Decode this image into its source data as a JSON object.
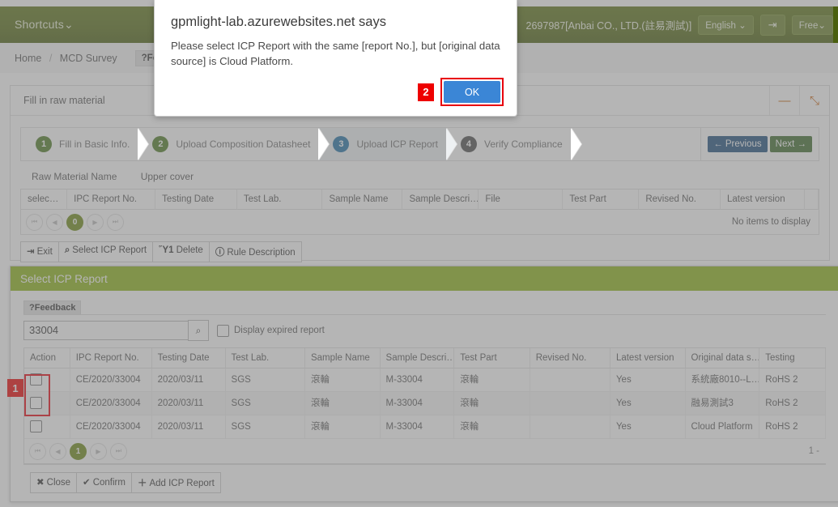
{
  "topbar": {
    "shortcuts_label": "Shortcuts",
    "chevron": "⌄",
    "user_info": "2697987[Anbai CO., LTD.(註易測試)]",
    "language_label": "English",
    "language_chevron": "⌄",
    "logout_icon": "⇥",
    "plan_label": "Free",
    "plan_chevron": "⌄"
  },
  "breadcrumb": {
    "home": "Home",
    "separator": "/",
    "section": "MCD Survey",
    "feedback_tab": "?Feedback"
  },
  "card": {
    "title": "Fill in raw material",
    "minimize_icon": "—",
    "expand_icon": "⤡"
  },
  "wizard": {
    "steps": [
      {
        "num": "1",
        "label": "Fill in Basic Info.",
        "state": "done"
      },
      {
        "num": "2",
        "label": "Upload Composition Datasheet",
        "state": "done"
      },
      {
        "num": "3",
        "label": "Upload ICP Report",
        "state": "active"
      },
      {
        "num": "4",
        "label": "Verify Compliance",
        "state": "pending"
      }
    ],
    "previous_label": "Previous",
    "previous_arrow": "←",
    "next_label": "Next",
    "next_arrow": "→"
  },
  "raw_material": {
    "label": "Raw Material Name",
    "value": "Upper cover"
  },
  "upper_grid": {
    "columns": [
      "selec…",
      "IPC Report No.",
      "Testing Date",
      "Test Lab.",
      "Sample Name",
      "Sample Descri…",
      "File",
      "Test Part",
      "Revised No.",
      "Latest version",
      ""
    ],
    "pager": {
      "first": "⏮",
      "prev": "◀",
      "page": "0",
      "next": "▶",
      "last": "⏭"
    },
    "empty_text": "No items to display"
  },
  "toolbar": {
    "buttons": [
      {
        "glyph": "⇥",
        "label": "Exit"
      },
      {
        "glyph": "⌕",
        "label": "Select ICP Report"
      },
      {
        "glyph": "Ὕ1",
        "label": "Delete"
      },
      {
        "glyph": "ⓘ",
        "label": "Rule Description"
      }
    ]
  },
  "modal": {
    "title": "Select ICP Report",
    "feedback_tab": "?Feedback",
    "search_value": "33004",
    "search_placeholder": "",
    "search_icon": "⌕",
    "expired_checkbox_label": "Display expired report",
    "columns": [
      "Action",
      "IPC Report No.",
      "Testing Date",
      "Test Lab.",
      "Sample Name",
      "Sample Descri…",
      "Test Part",
      "Revised No.",
      "Latest version",
      "Original data s…",
      "Testing"
    ],
    "rows": [
      {
        "report_no": "CE/2020/33004",
        "testing_date": "2020/03/11",
        "test_lab": "SGS",
        "sample_name": "滾輪",
        "sample_desc": "M-33004",
        "test_part": "滾輪",
        "revised_no": "",
        "latest_version": "Yes",
        "original_source": "系統廠8010--L…",
        "testing_std": "RoHS 2"
      },
      {
        "report_no": "CE/2020/33004",
        "testing_date": "2020/03/11",
        "test_lab": "SGS",
        "sample_name": "滾輪",
        "sample_desc": "M-33004",
        "test_part": "滾輪",
        "revised_no": "",
        "latest_version": "Yes",
        "original_source": "融易測試3",
        "testing_std": "RoHS 2"
      },
      {
        "report_no": "CE/2020/33004",
        "testing_date": "2020/03/11",
        "test_lab": "SGS",
        "sample_name": "滾輪",
        "sample_desc": "M-33004",
        "test_part": "滾輪",
        "revised_no": "",
        "latest_version": "Yes",
        "original_source": "Cloud Platform",
        "testing_std": "RoHS 2"
      }
    ],
    "pager": {
      "first": "⏮",
      "prev": "◀",
      "page": "1",
      "next": "▶",
      "last": "⏭"
    },
    "count_text": "1 -",
    "footer_buttons": [
      {
        "glyph": "✖",
        "label": "Close"
      },
      {
        "glyph": "✔",
        "label": "Confirm"
      },
      {
        "glyph": "＋",
        "label": "Add ICP Report"
      }
    ]
  },
  "dialog": {
    "title": "gpmlight-lab.azurewebsites.net says",
    "message": "Please select ICP Report with the same [report No.], but [original data source] is Cloud Platform.",
    "ok_label": "OK"
  },
  "annotations": [
    {
      "num": "1"
    },
    {
      "num": "2"
    }
  ],
  "colors": {
    "brand_green": "#5d7417",
    "modal_green": "#8db315",
    "active_step_blue": "#1d6fa5",
    "done_step_green": "#4d7a23",
    "ok_button_blue": "#3b86d6",
    "annotation_red": "#ee0000"
  }
}
